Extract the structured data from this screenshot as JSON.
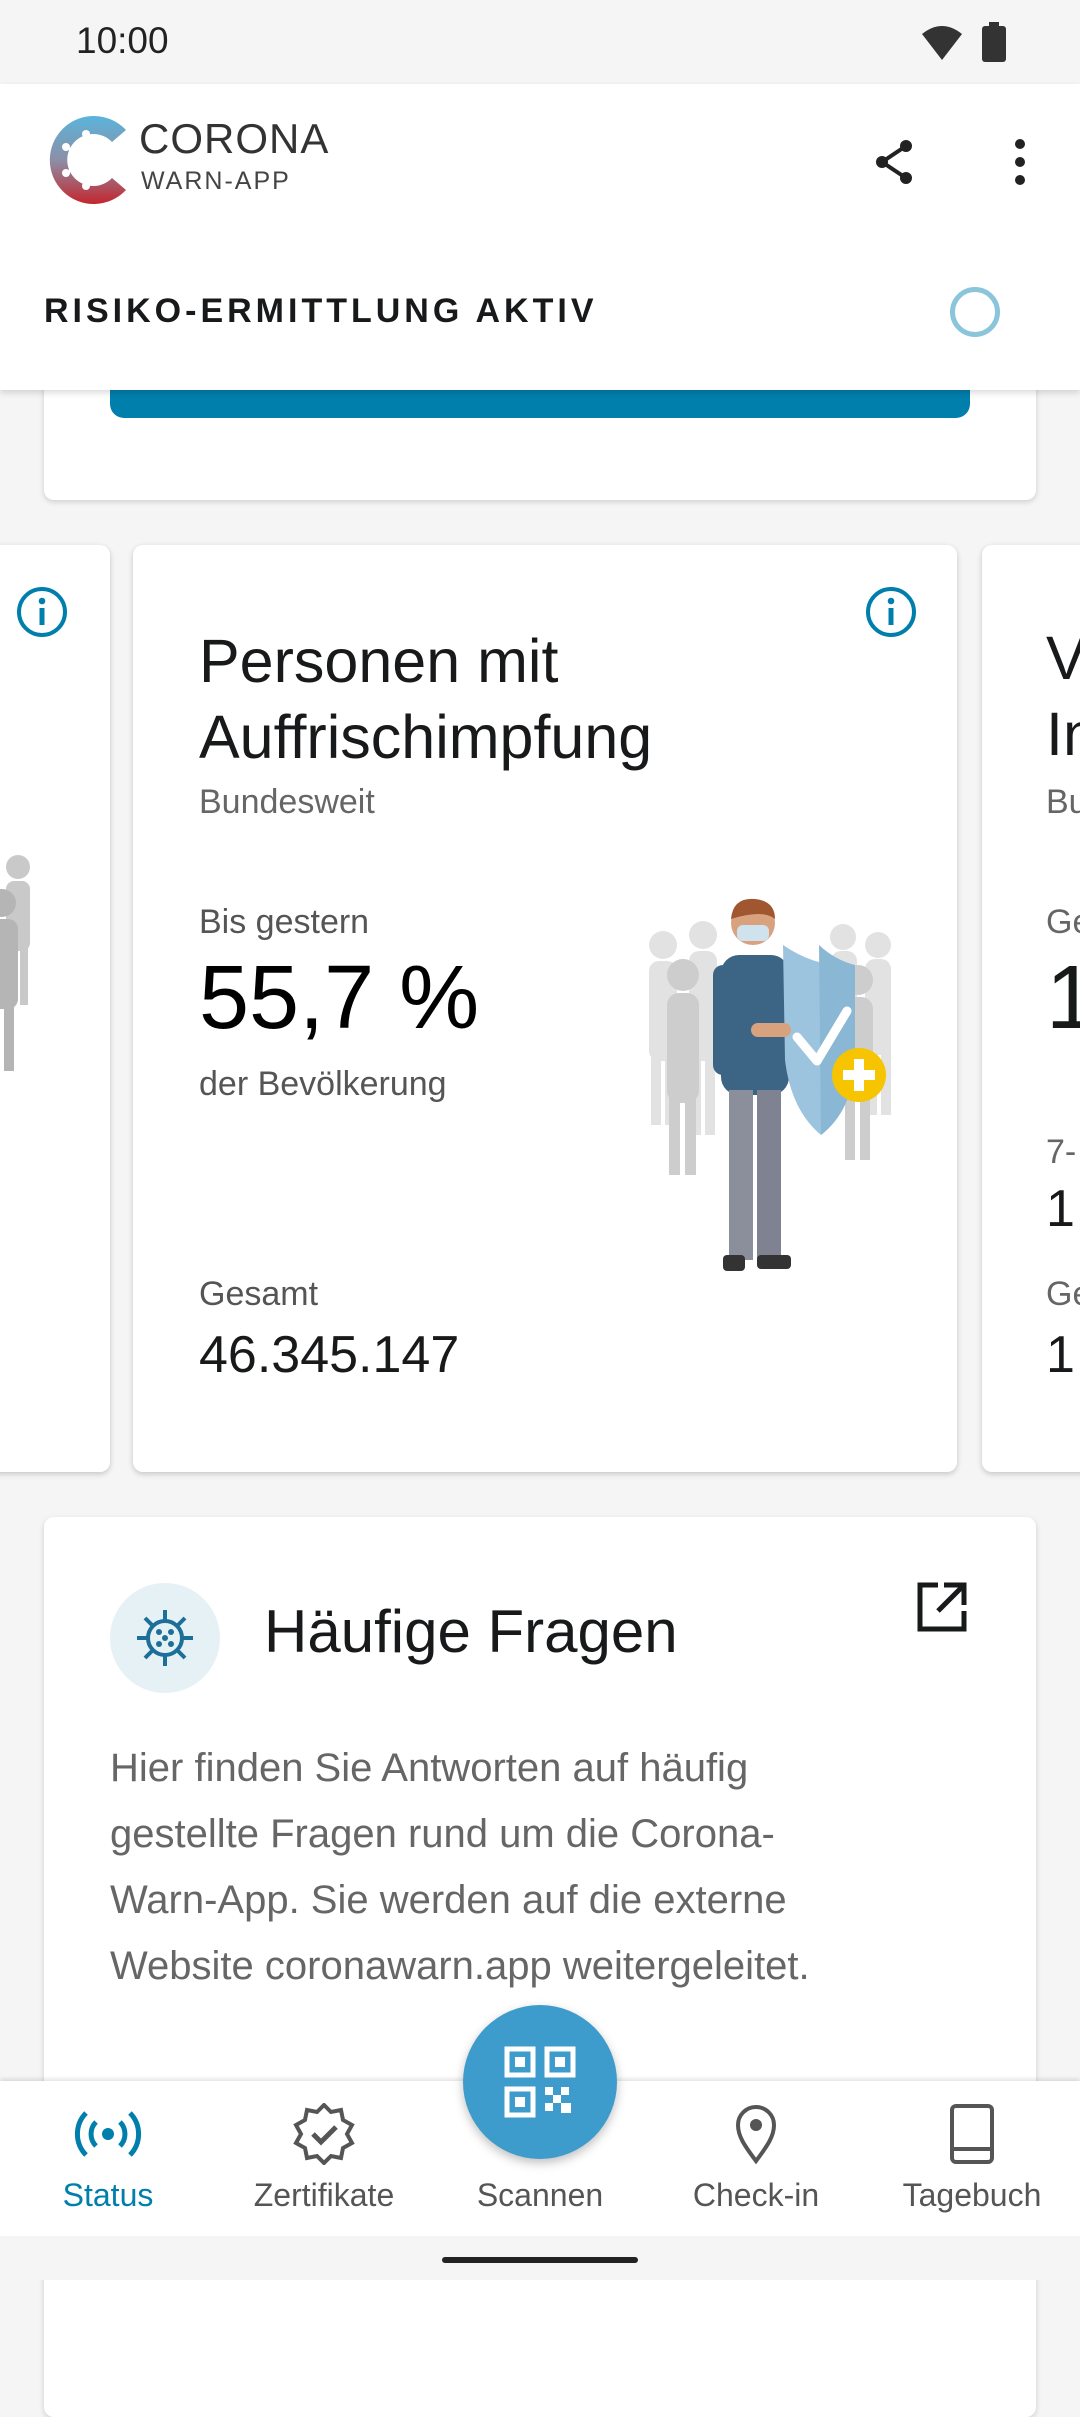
{
  "status_bar": {
    "time": "10:00"
  },
  "app_bar": {
    "name_line1": "CORONA",
    "name_line2": "WARN-APP"
  },
  "risk": {
    "label": "RISIKO-ERMITTLUNG AKTIV"
  },
  "statistics": {
    "title": "Personen mit Auffrischimpfung",
    "region": "Bundesweit",
    "label_yesterday": "Bis gestern",
    "value": "55,7 %",
    "value_sub": "der Bevölkerung",
    "label_total": "Gesamt",
    "total": "46.345.147",
    "right_card_peek": {
      "title_line1": "V",
      "title_line2": "In",
      "region": "Bu",
      "label1": "Ge",
      "value1": "1",
      "label2": "7-",
      "value2": "1",
      "label3": "Ge",
      "value3": "1"
    }
  },
  "faq": {
    "title": "Häufige Fragen",
    "body": "Hier finden Sie Antworten auf häufig gestellte Fragen rund um die Corona-Warn-App. Sie werden auf die externe Website coronawarn.app weitergeleitet."
  },
  "nav": {
    "status": "Status",
    "certificates": "Zertifikate",
    "scan": "Scannen",
    "checkin": "Check-in",
    "diary": "Tagebuch"
  },
  "colors": {
    "accent": "#007fad",
    "fab": "#3d9ccc",
    "spinner": "#8ac5da",
    "badge": "#f6c400"
  },
  "icons": [
    "wifi-icon",
    "battery-icon",
    "share-icon",
    "more-vert-icon",
    "info-icon",
    "virus-icon",
    "open-external-icon",
    "broadcast-icon",
    "certificate-icon",
    "qr-code-icon",
    "location-pin-icon",
    "book-icon"
  ]
}
